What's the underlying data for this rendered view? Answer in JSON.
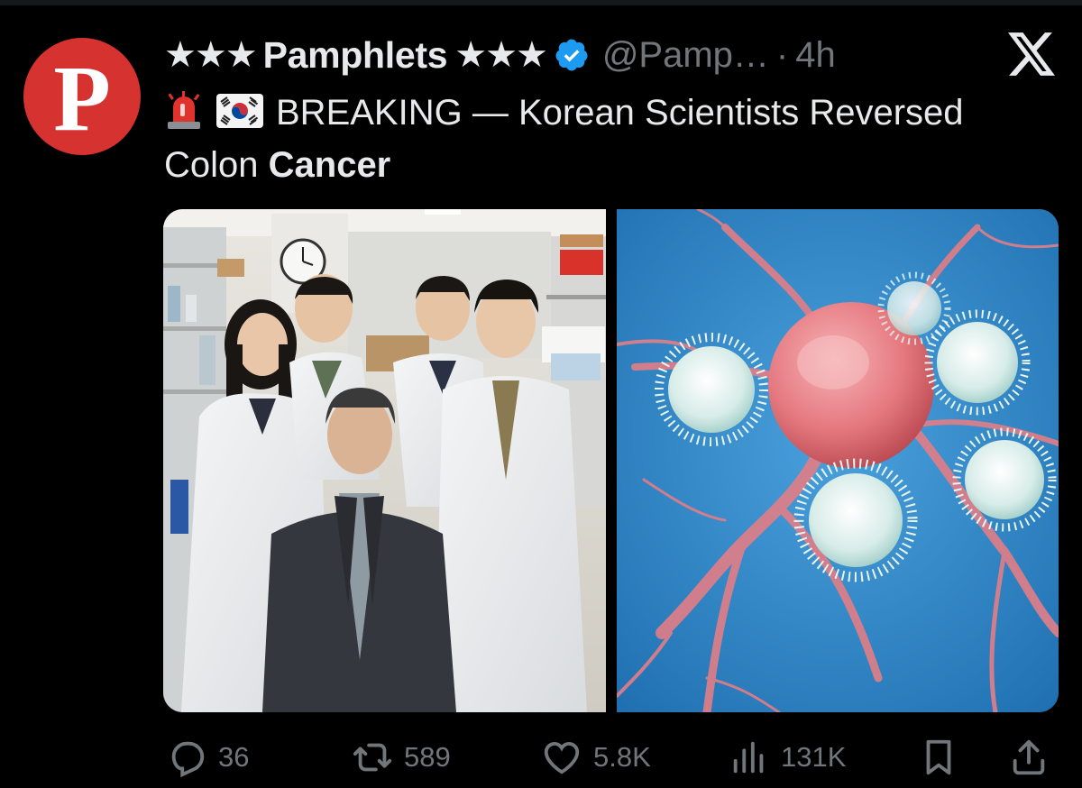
{
  "avatar": {
    "letter": "P",
    "color": "#d6322f"
  },
  "post": {
    "stars_left": "★★★",
    "display_name": "Pamphlets",
    "stars_right": "★★★",
    "handle": "@Pamp…",
    "separator": "·",
    "time": "4h",
    "text_lead": "BREAKING —  Korean Scientists Reversed Colon ",
    "text_bold": "Cancer",
    "emoji_1": "police-light-emoji",
    "emoji_2": "south-korea-flag-emoji"
  },
  "media": [
    {
      "description_icon": "lab-team-photo"
    },
    {
      "description_icon": "cancer-cell-illustration"
    }
  ],
  "actions": {
    "replies": "36",
    "reposts": "589",
    "likes": "5.8K",
    "views": "131K"
  },
  "colors": {
    "background": "#000000",
    "text": "#e7e9ea",
    "muted": "#71767b",
    "verified": "#1d9bf0"
  }
}
